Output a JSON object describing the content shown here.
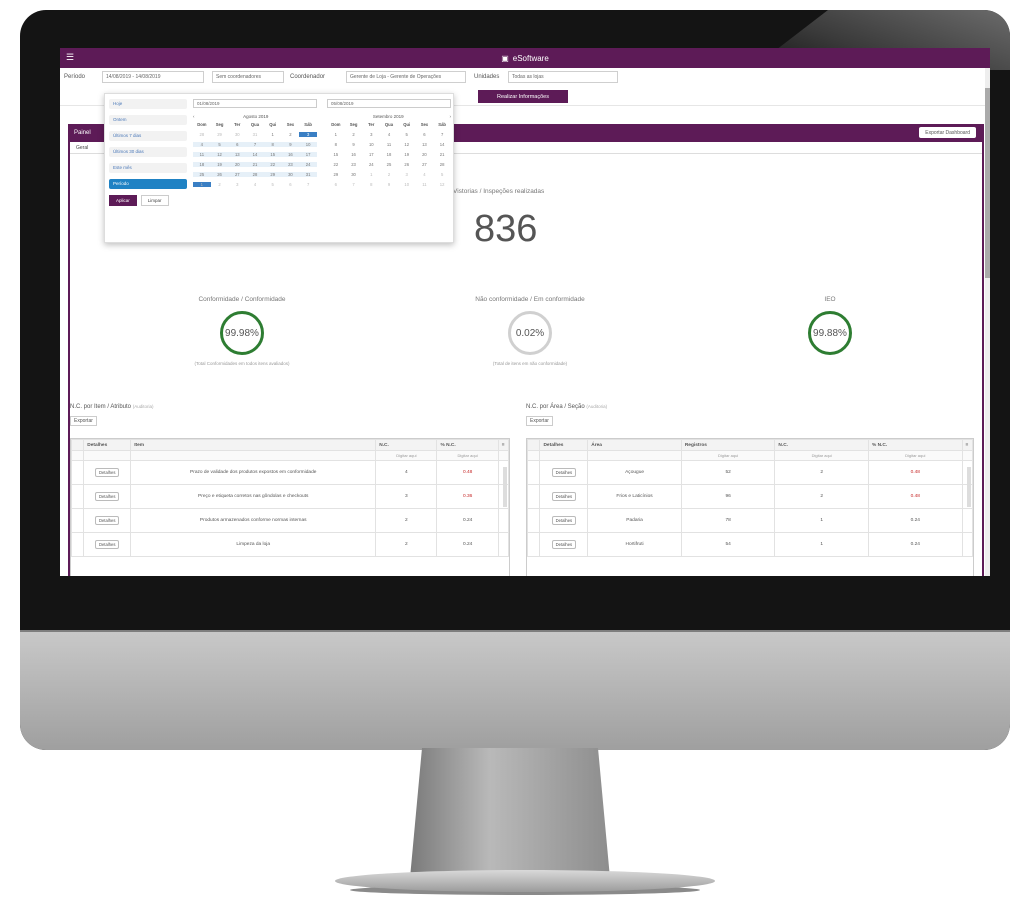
{
  "app": {
    "title": "eSoftware"
  },
  "filters": {
    "period_label": "Período",
    "period_value": "14/08/2019 - 14/08/2019",
    "coordination_select": "Sem coordenadores",
    "coordination_label": "Coordenador",
    "coordination_value": "Gerente de Loja - Gerente de Operações",
    "store_label": "Unidades",
    "store_value": "Todas as lojas",
    "apply_button": "Realizar Informações"
  },
  "date_picker": {
    "ranges": [
      "Hoje",
      "Ontem",
      "Últimos 7 dias",
      "Últimos 30 dias",
      "Este mês",
      "Período"
    ],
    "active_range": "Período",
    "apply_label": "Aplicar",
    "cancel_label": "Limpar",
    "left_input": "01/08/2019",
    "right_input": "05/08/2019",
    "left_month": "Agosto 2019",
    "right_month": "Setembro 2019",
    "weekdays": [
      "Dom",
      "Seg",
      "Ter",
      "Qua",
      "Qui",
      "Sex",
      "Sáb"
    ],
    "left_days": [
      "28",
      "29",
      "30",
      "31",
      "1",
      "2",
      "3",
      "4",
      "5",
      "6",
      "7",
      "8",
      "9",
      "10",
      "11",
      "12",
      "13",
      "14",
      "15",
      "16",
      "17",
      "18",
      "19",
      "20",
      "21",
      "22",
      "23",
      "24",
      "25",
      "26",
      "27",
      "28",
      "29",
      "30",
      "31",
      "1",
      "2",
      "3",
      "4",
      "5",
      "6",
      "7"
    ],
    "right_days": [
      "1",
      "2",
      "3",
      "4",
      "5",
      "6",
      "7",
      "8",
      "9",
      "10",
      "11",
      "12",
      "13",
      "14",
      "15",
      "16",
      "17",
      "18",
      "19",
      "20",
      "21",
      "22",
      "23",
      "24",
      "25",
      "26",
      "27",
      "28",
      "29",
      "30",
      "1",
      "2",
      "3",
      "4",
      "5",
      "6",
      "7",
      "8",
      "9",
      "10",
      "11",
      "12"
    ]
  },
  "panel": {
    "title": "Painel",
    "export_button": "Exportar Dashboard",
    "subtab": "Geral"
  },
  "summary": {
    "label": "Vistorias / Inspeções realizadas",
    "value": "836"
  },
  "kpis": [
    {
      "title": "Conformidade / Conformidade",
      "value": "99.98%",
      "sub": "(Total Conformidades em todos itens avaliados)",
      "color": "green"
    },
    {
      "title": "Não conformidade / Em conformidade",
      "value": "0.02%",
      "sub": "(Total de itens em não conformidade)",
      "color": "grey"
    },
    {
      "title": "IEO",
      "value": "99.88%",
      "sub": "",
      "color": "green"
    }
  ],
  "table_left": {
    "title": "N.C. por Item / Atributo",
    "title_note": "(Auditoria)",
    "tag": "Exportar",
    "headers": [
      "Detalhes",
      "Item",
      "N.C.",
      "% N.C."
    ],
    "filter_placeholders": [
      "",
      "",
      "Digitar aqui",
      "Digitar aqui"
    ],
    "rows": [
      {
        "detail": "Detalhes",
        "item": "Prazo de validade dos produtos expostos em conformidade",
        "nc": "4",
        "pct": "0.48"
      },
      {
        "detail": "Detalhes",
        "item": "Preço e etiqueta corretos nas gôndolas e checkouts",
        "nc": "3",
        "pct": "0.36"
      },
      {
        "detail": "Detalhes",
        "item": "Produtos armazenados conforme normas internas",
        "nc": "2",
        "pct": "0.24"
      },
      {
        "detail": "Detalhes",
        "item": "Limpeza da loja",
        "nc": "2",
        "pct": "0.24"
      }
    ]
  },
  "table_right": {
    "title": "N.C. por Área / Seção",
    "title_note": "(Auditoria)",
    "tag": "Exportar",
    "headers": [
      "Detalhes",
      "Área",
      "Registros",
      "N.C.",
      "% N.C."
    ],
    "filter_placeholders": [
      "",
      "",
      "Digitar aqui",
      "Digitar aqui",
      "Digitar aqui"
    ],
    "rows": [
      {
        "detail": "Detalhes",
        "area": "Açougue",
        "reg": "52",
        "nc": "2",
        "pct": "0.48"
      },
      {
        "detail": "Detalhes",
        "area": "Frios e Laticínios",
        "reg": "96",
        "nc": "2",
        "pct": "0.48"
      },
      {
        "detail": "Detalhes",
        "area": "Padaria",
        "reg": "78",
        "nc": "1",
        "pct": "0.24"
      },
      {
        "detail": "Detalhes",
        "area": "Hortifruti",
        "reg": "54",
        "nc": "1",
        "pct": "0.24"
      }
    ]
  },
  "colors": {
    "brand": "#5d1b57",
    "ok": "#2e7d32",
    "accent": "#1f82c4"
  }
}
